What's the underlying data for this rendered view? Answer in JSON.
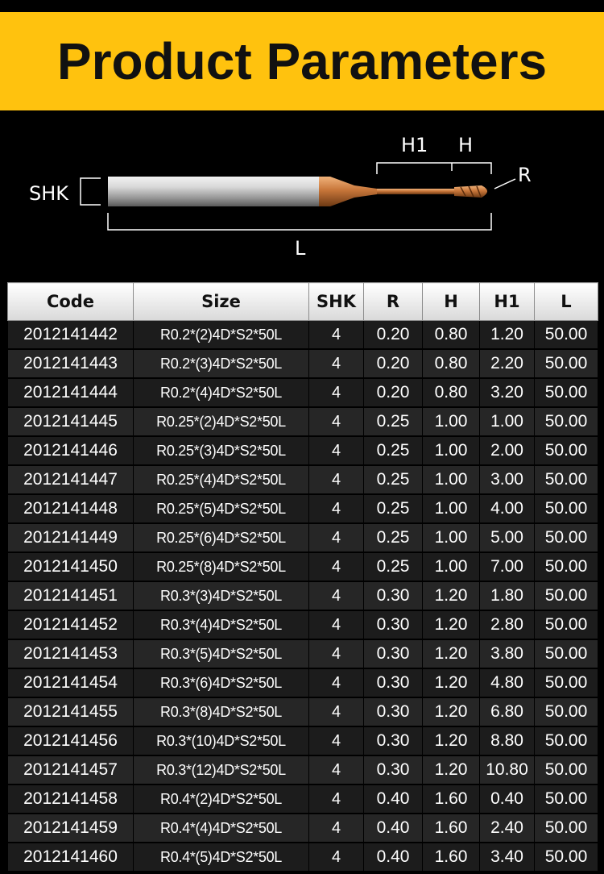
{
  "page": {
    "title": "Product Parameters",
    "accent_color": "#ffc20e",
    "background_color": "#000000"
  },
  "diagram": {
    "labels": {
      "h1": "H1",
      "h": "H",
      "r": "R",
      "shk": "SHK",
      "l": "L"
    },
    "tool_shank_color": "#c9c9c9",
    "tool_coating_color": "#c8763a"
  },
  "table": {
    "headers": [
      "Code",
      "Size",
      "SHK",
      "R",
      "H",
      "H1",
      "L"
    ],
    "rows": [
      [
        "2012141442",
        "R0.2*(2)4D*S2*50L",
        "4",
        "0.20",
        "0.80",
        "1.20",
        "50.00"
      ],
      [
        "2012141443",
        "R0.2*(3)4D*S2*50L",
        "4",
        "0.20",
        "0.80",
        "2.20",
        "50.00"
      ],
      [
        "2012141444",
        "R0.2*(4)4D*S2*50L",
        "4",
        "0.20",
        "0.80",
        "3.20",
        "50.00"
      ],
      [
        "2012141445",
        "R0.25*(2)4D*S2*50L",
        "4",
        "0.25",
        "1.00",
        "1.00",
        "50.00"
      ],
      [
        "2012141446",
        "R0.25*(3)4D*S2*50L",
        "4",
        "0.25",
        "1.00",
        "2.00",
        "50.00"
      ],
      [
        "2012141447",
        "R0.25*(4)4D*S2*50L",
        "4",
        "0.25",
        "1.00",
        "3.00",
        "50.00"
      ],
      [
        "2012141448",
        "R0.25*(5)4D*S2*50L",
        "4",
        "0.25",
        "1.00",
        "4.00",
        "50.00"
      ],
      [
        "2012141449",
        "R0.25*(6)4D*S2*50L",
        "4",
        "0.25",
        "1.00",
        "5.00",
        "50.00"
      ],
      [
        "2012141450",
        "R0.25*(8)4D*S2*50L",
        "4",
        "0.25",
        "1.00",
        "7.00",
        "50.00"
      ],
      [
        "2012141451",
        "R0.3*(3)4D*S2*50L",
        "4",
        "0.30",
        "1.20",
        "1.80",
        "50.00"
      ],
      [
        "2012141452",
        "R0.3*(4)4D*S2*50L",
        "4",
        "0.30",
        "1.20",
        "2.80",
        "50.00"
      ],
      [
        "2012141453",
        "R0.3*(5)4D*S2*50L",
        "4",
        "0.30",
        "1.20",
        "3.80",
        "50.00"
      ],
      [
        "2012141454",
        "R0.3*(6)4D*S2*50L",
        "4",
        "0.30",
        "1.20",
        "4.80",
        "50.00"
      ],
      [
        "2012141455",
        "R0.3*(8)4D*S2*50L",
        "4",
        "0.30",
        "1.20",
        "6.80",
        "50.00"
      ],
      [
        "2012141456",
        "R0.3*(10)4D*S2*50L",
        "4",
        "0.30",
        "1.20",
        "8.80",
        "50.00"
      ],
      [
        "2012141457",
        "R0.3*(12)4D*S2*50L",
        "4",
        "0.30",
        "1.20",
        "10.80",
        "50.00"
      ],
      [
        "2012141458",
        "R0.4*(2)4D*S2*50L",
        "4",
        "0.40",
        "1.60",
        "0.40",
        "50.00"
      ],
      [
        "2012141459",
        "R0.4*(4)4D*S2*50L",
        "4",
        "0.40",
        "1.60",
        "2.40",
        "50.00"
      ],
      [
        "2012141460",
        "R0.4*(5)4D*S2*50L",
        "4",
        "0.40",
        "1.60",
        "3.40",
        "50.00"
      ]
    ]
  }
}
